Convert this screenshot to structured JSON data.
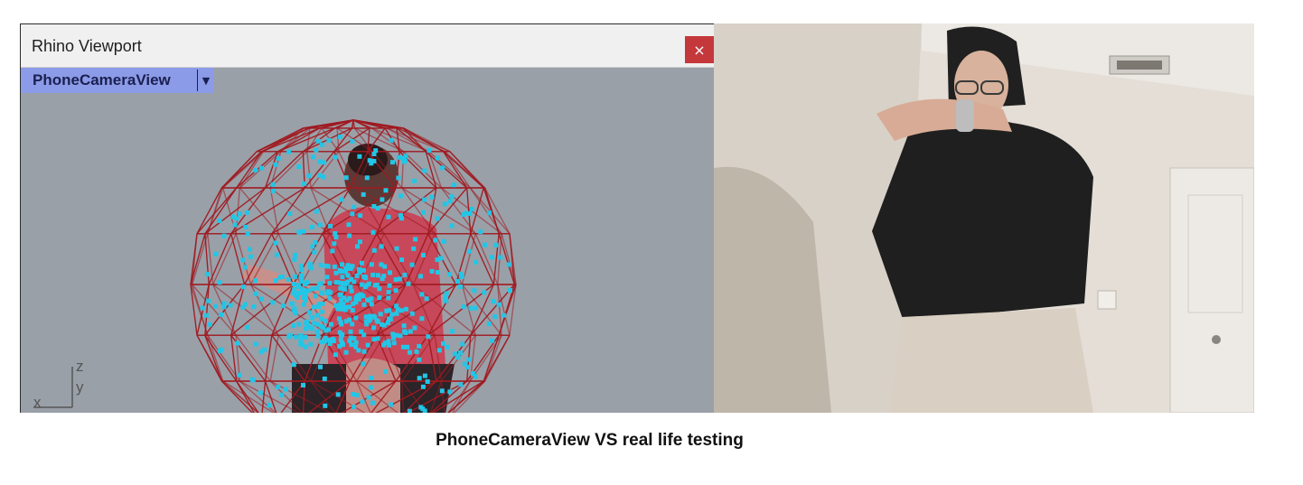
{
  "window": {
    "title": "Rhino Viewport",
    "close_glyph": "×",
    "viewport_name": "PhoneCameraView",
    "dropdown_glyph": "▼",
    "axes": {
      "z": "z",
      "y": "y",
      "x": "x"
    }
  },
  "caption": "PhoneCameraView VS real life testing",
  "colors": {
    "viewport_bg": "#9aa0a8",
    "titlebar_bg": "#f0f0f0",
    "close_bg": "#c4383c",
    "viewport_tab_bg": "#8c9be8",
    "mesh": "#a01a20",
    "points": "#22c6e6"
  },
  "icons": {
    "close": "close-icon",
    "dropdown": "chevron-down-icon"
  }
}
